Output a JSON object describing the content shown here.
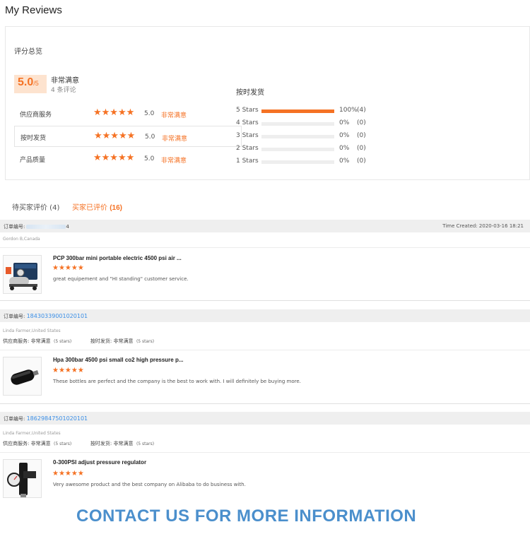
{
  "page_title": "My Reviews",
  "summary": {
    "heading": "评分总览",
    "score": "5.0",
    "score_max": "/5",
    "score_label": "非常满意",
    "review_count": "4 条评论",
    "ratings": [
      {
        "name": "供应商服务",
        "stars": "★★★★★",
        "value": "5.0",
        "word": "非常满意"
      },
      {
        "name": "按时发货",
        "stars": "★★★★★",
        "value": "5.0",
        "word": "非常满意"
      },
      {
        "name": "产品质量",
        "stars": "★★★★★",
        "value": "5.0",
        "word": "非常满意"
      }
    ],
    "distribution_title": "按时发货",
    "distribution": [
      {
        "label": "5 Stars",
        "fraction": 1.0,
        "percent": "100%",
        "count": "(4)"
      },
      {
        "label": "4 Stars",
        "fraction": 0.0,
        "percent": "0%",
        "count": "(0)"
      },
      {
        "label": "3 Stars",
        "fraction": 0.0,
        "percent": "0%",
        "count": "(0)"
      },
      {
        "label": "2 Stars",
        "fraction": 0.0,
        "percent": "0%",
        "count": "(0)"
      },
      {
        "label": "1 Stars",
        "fraction": 0.0,
        "percent": "0%",
        "count": "(0)"
      }
    ]
  },
  "tabs": {
    "pending": "待买家评价 (4)",
    "reviewed_label": "买家已评价",
    "reviewed_count": "(16)"
  },
  "orders": [
    {
      "order_label": "订单编号:",
      "order_no": "4",
      "time_created": "Time Created: 2020-03-16 18:21",
      "buyer": "Gordon B,Canada",
      "product_title": "PCP 300bar mini portable electric 4500 psi air ...",
      "stars": "★★★★★",
      "review": "great equipement and  \"HI standing\" customer service."
    },
    {
      "order_label": "订单编号:",
      "order_no": "184303390010201​01",
      "buyer": "Linda Farmer,United States",
      "supplier_label": "供应商服务:",
      "supplier_value": "非常满意",
      "supplier_stars": "(5 stars)",
      "shipping_label": "按时发货:",
      "shipping_value": "非常满意",
      "shipping_stars": "(5 stars)",
      "product_title": "Hpa 300bar 4500 psi small co2 high pressure p...",
      "stars": "★★★★★",
      "review": "These bottles are perfect and the company is the best to work with. I will definitely be buying more."
    },
    {
      "order_label": "订单编号:",
      "order_no": "186298475010201​01",
      "buyer": "Linda Farmer,United States",
      "supplier_label": "供应商服务:",
      "supplier_value": "非常满意",
      "supplier_stars": "(5 stars)",
      "shipping_label": "按时发货:",
      "shipping_value": "非常满意",
      "shipping_stars": "(5 stars)",
      "product_title": "0-300PSI adjust pressure regulator",
      "stars": "★★★★★",
      "review": "Very awesome product and the best company on Alibaba to do business with."
    }
  ],
  "banner": "CONTACT US FOR MORE INFORMATION",
  "colors": {
    "accent": "#f57224",
    "link": "#3a8ee6",
    "banner": "#4b8fcc"
  }
}
